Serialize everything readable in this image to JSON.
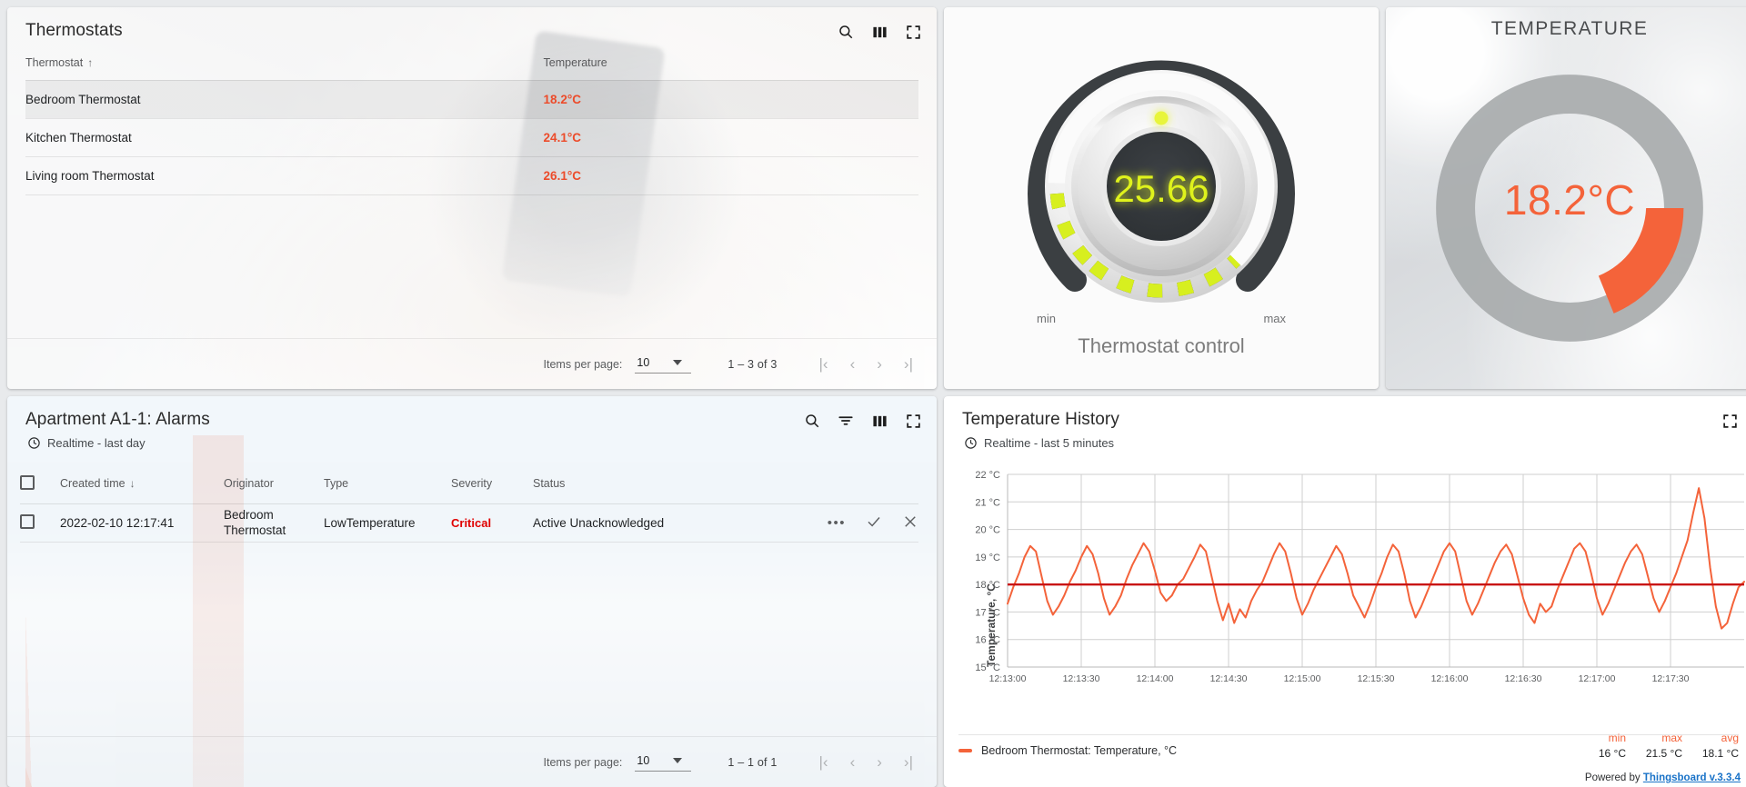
{
  "thermostats_panel": {
    "title": "Thermostats",
    "icons": [
      "search-icon",
      "columns-icon",
      "fullscreen-icon"
    ],
    "columns": [
      "Thermostat",
      "Temperature"
    ],
    "sort_indicator": "↑",
    "rows": [
      {
        "name": "Bedroom Thermostat",
        "temperature": "18.2°C",
        "selected": true
      },
      {
        "name": "Kitchen Thermostat",
        "temperature": "24.1°C",
        "selected": false
      },
      {
        "name": "Living room Thermostat",
        "temperature": "26.1°C",
        "selected": false
      }
    ],
    "pager": {
      "items_per_page_label": "Items per page:",
      "items_per_page_value": "10",
      "range": "1 – 3 of 3",
      "first": "|‹",
      "prev": "‹",
      "next": "›",
      "last": "›|"
    }
  },
  "thermostat_control": {
    "title": "Thermostat control",
    "value": "25.66",
    "min_label": "min",
    "max_label": "max",
    "value_color": "#d7ef1f",
    "scale_color": "#d7ef1f",
    "dark_color": "#3b3f42",
    "percent": 55
  },
  "temperature_gauge": {
    "title": "TEMPERATURE",
    "value": "18.2°C",
    "value_color": "#f4633a",
    "track_color": "#a8abad",
    "fill_start_deg": 90,
    "fill_sweep_deg": 40
  },
  "alarms_panel": {
    "title": "Apartment A1-1: Alarms",
    "subtitle": "Realtime - last day",
    "icons": [
      "search-icon",
      "filter-icon",
      "columns-icon",
      "fullscreen-icon"
    ],
    "columns": [
      "Created time",
      "Originator",
      "Type",
      "Severity",
      "Status"
    ],
    "sort_indicator": "↓",
    "rows": [
      {
        "created_time": "2022-02-10 12:17:41",
        "originator": "Bedroom Thermostat",
        "type": "LowTemperature",
        "severity": "Critical",
        "severity_color": "#e00000",
        "status": "Active Unacknowledged",
        "actions": [
          "more-icon",
          "acknowledge-icon",
          "clear-icon"
        ]
      }
    ],
    "pager": {
      "items_per_page_label": "Items per page:",
      "items_per_page_value": "10",
      "range": "1 – 1 of 1",
      "first": "|‹",
      "prev": "‹",
      "next": "›",
      "last": "›|"
    }
  },
  "history_panel": {
    "title": "Temperature History",
    "subtitle": "Realtime - last 5 minutes",
    "icons": [
      "fullscreen-icon"
    ],
    "legend_label": "Bedroom Thermostat: Temperature, °C",
    "stats": [
      {
        "header": "min",
        "value": "16 °C"
      },
      {
        "header": "max",
        "value": "21.5 °C"
      },
      {
        "header": "avg",
        "value": "18.1 °C"
      }
    ],
    "powered_by_prefix": "Powered by ",
    "powered_by_link": "Thingsboard v.3.3.4"
  },
  "chart_data": {
    "type": "line",
    "title": "Temperature History",
    "subtitle": "Realtime - last 5 minutes",
    "xlabel": "",
    "ylabel": "Temperature, °C",
    "ylim": [
      15,
      22
    ],
    "yticks": [
      "15 °C",
      "16 °C",
      "17 °C",
      "18 °C",
      "19 °C",
      "20 °C",
      "21 °C",
      "22 °C"
    ],
    "ytick_values": [
      15,
      16,
      17,
      18,
      19,
      20,
      21,
      22
    ],
    "xticks": [
      "12:13:00",
      "12:13:30",
      "12:14:00",
      "12:14:30",
      "12:15:00",
      "12:15:30",
      "12:16:00",
      "12:16:30",
      "12:17:00",
      "12:17:30"
    ],
    "grid": true,
    "legend_position": "bottom-left",
    "series": [
      {
        "name": "Bedroom Thermostat: Temperature, °C",
        "color": "#f4633a",
        "min": 16,
        "max": 21.5,
        "avg": 18.1,
        "values": [
          17.3,
          17.9,
          18.4,
          19.0,
          19.4,
          19.2,
          18.3,
          17.4,
          16.9,
          17.2,
          17.6,
          18.1,
          18.5,
          19.0,
          19.4,
          19.1,
          18.4,
          17.5,
          16.9,
          17.2,
          17.6,
          18.2,
          18.7,
          19.1,
          19.5,
          19.2,
          18.5,
          17.7,
          17.4,
          17.6,
          18.0,
          18.2,
          18.6,
          19.0,
          19.45,
          19.2,
          18.3,
          17.4,
          16.7,
          17.3,
          16.6,
          17.1,
          16.8,
          17.4,
          17.8,
          18.1,
          18.6,
          19.1,
          19.5,
          19.2,
          18.4,
          17.5,
          16.9,
          17.3,
          17.8,
          18.2,
          18.6,
          19.0,
          19.4,
          19.1,
          18.4,
          17.6,
          17.2,
          16.8,
          17.3,
          17.9,
          18.4,
          19.0,
          19.45,
          19.2,
          18.4,
          17.4,
          16.8,
          17.2,
          17.7,
          18.2,
          18.7,
          19.2,
          19.5,
          19.2,
          18.3,
          17.4,
          16.9,
          17.3,
          17.8,
          18.3,
          18.8,
          19.2,
          19.45,
          19.1,
          18.3,
          17.5,
          16.9,
          16.6,
          17.3,
          17.0,
          17.2,
          17.8,
          18.3,
          18.8,
          19.3,
          19.5,
          19.2,
          18.4,
          17.5,
          16.9,
          17.3,
          17.8,
          18.3,
          18.8,
          19.2,
          19.45,
          19.1,
          18.3,
          17.5,
          17.0,
          17.4,
          17.9,
          18.4,
          19.0,
          19.6,
          20.6,
          21.5,
          20.4,
          18.6,
          17.2,
          16.4,
          16.6,
          17.3,
          17.9,
          18.1
        ]
      }
    ],
    "threshold_line": {
      "value": 18,
      "color": "#c81414"
    }
  }
}
